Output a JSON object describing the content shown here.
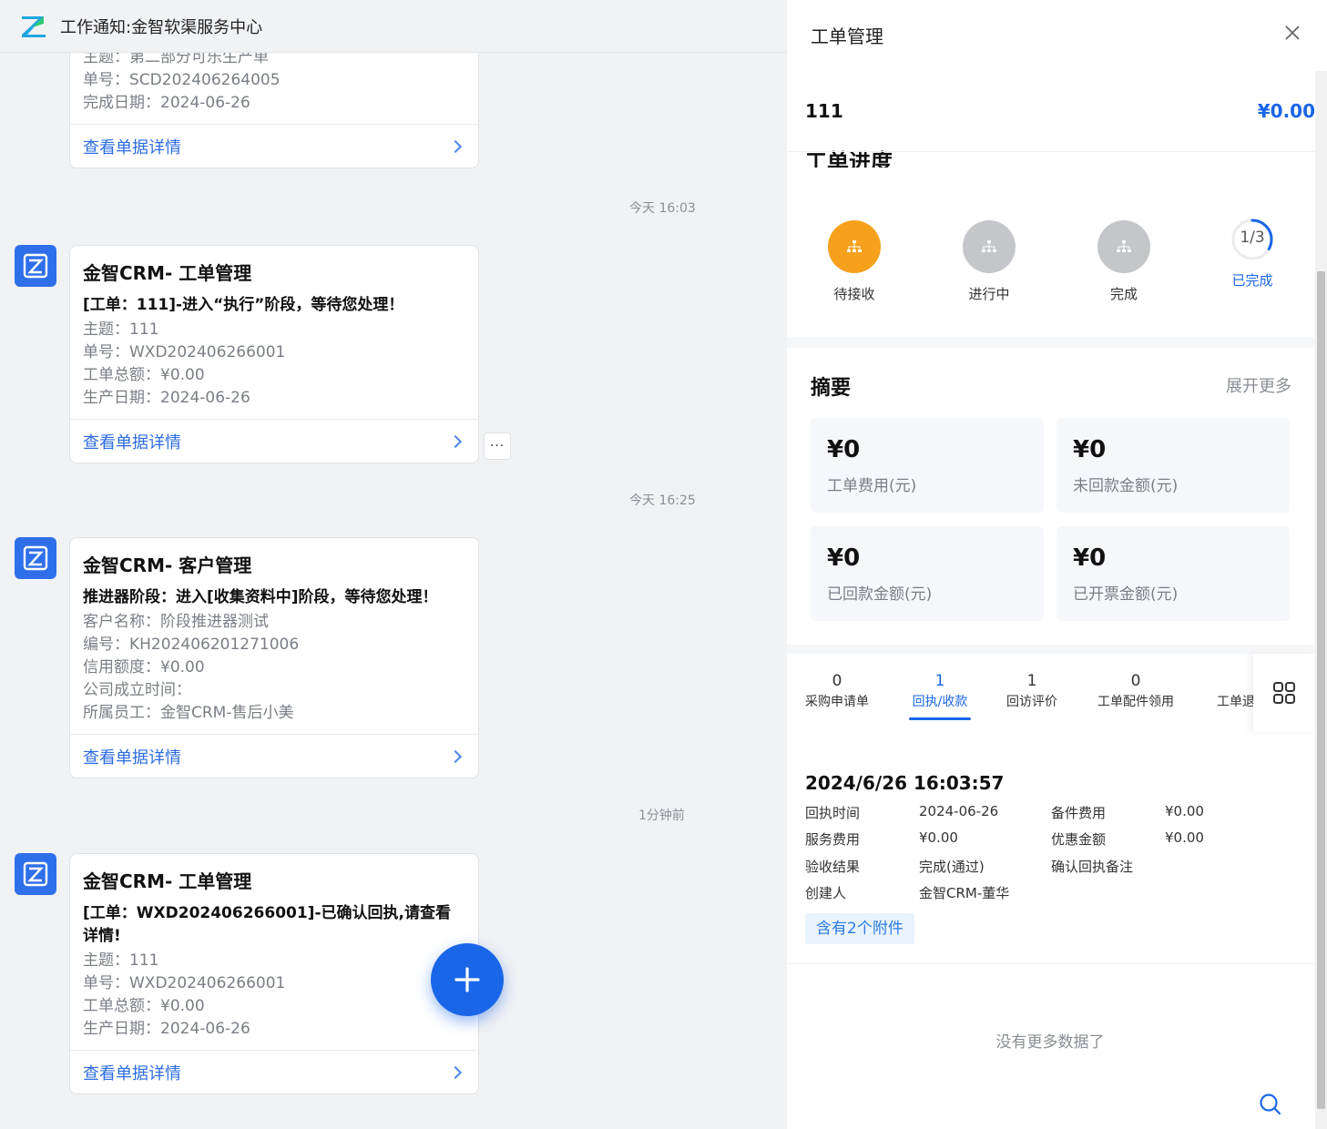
{
  "topbar": {
    "title": "工作通知:金智软渠服务中心"
  },
  "chat": {
    "partial_card": {
      "lines": [
        "主题：第二部分可乐生产单",
        "单号：SCD202406264005",
        "完成日期：2024-06-26"
      ],
      "link": "查看单据详情"
    },
    "messages": [
      {
        "time": "今天 16:03",
        "app": "金智CRM- 工单管理",
        "headline": "[工单：111]-进入“执行”阶段，等待您处理！",
        "lines": [
          "主题：111",
          "单号：WXD202406266001",
          "工单总额：¥0.00",
          "生产日期：2024-06-26"
        ],
        "link": "查看单据详情"
      },
      {
        "time": "今天 16:25",
        "app": "金智CRM- 客户管理",
        "headline": "推进器阶段：进入[收集资料中]阶段，等待您处理！",
        "lines": [
          "客户名称：阶段推进器测试",
          "编号：KH202406201271006",
          "信用额度：¥0.00",
          "公司成立时间：",
          "所属员工：金智CRM-售后小美"
        ],
        "link": "查看单据详情"
      },
      {
        "time": "1分钟前",
        "app": "金智CRM- 工单管理",
        "headline": "[工单：WXD202406266001]-已确认回执,请查看详情!",
        "lines": [
          "主题：111",
          "单号：WXD202406266001",
          "工单总额：¥0.00",
          "生产日期：2024-06-26"
        ],
        "link": "查看单据详情"
      }
    ],
    "more_button": "···"
  },
  "panel": {
    "title": "工单管理",
    "order_name": "111",
    "order_amount": "¥0.00",
    "progress_title": "工单进度",
    "steps": [
      {
        "label": "待接收",
        "state": "current"
      },
      {
        "label": "进行中",
        "state": "pending"
      },
      {
        "label": "完成",
        "state": "pending"
      }
    ],
    "progress_ratio": "1/3",
    "progress_fraction": 0.333,
    "progress_label": "已完成",
    "summary": {
      "title": "摘要",
      "expand": "展开更多",
      "tiles": [
        {
          "value": "¥0",
          "label": "工单费用(元)"
        },
        {
          "value": "¥0",
          "label": "未回款金额(元)"
        },
        {
          "value": "¥0",
          "label": "已回款金额(元)"
        },
        {
          "value": "¥0",
          "label": "已开票金额(元)"
        }
      ]
    },
    "tabs": [
      {
        "count": "0",
        "label": "采购申请单"
      },
      {
        "count": "1",
        "label": "回执/收款",
        "active": true
      },
      {
        "count": "1",
        "label": "回访评价"
      },
      {
        "count": "0",
        "label": "工单配件领用"
      },
      {
        "count": "",
        "label": "工单退"
      }
    ],
    "record": {
      "datetime": "2024/6/26 16:03:57",
      "fields": [
        {
          "k": "回执时间",
          "v": "2024-06-26"
        },
        {
          "k": "备件费用",
          "v": "¥0.00"
        },
        {
          "k": "服务费用",
          "v": "¥0.00"
        },
        {
          "k": "优惠金额",
          "v": "¥0.00"
        },
        {
          "k": "验收结果",
          "v": "完成(通过)"
        },
        {
          "k": "确认回执备注",
          "v": ""
        },
        {
          "k": "创建人",
          "v": "金智CRM-董华"
        }
      ],
      "attachments": "含有2个附件"
    },
    "no_more": "没有更多数据了"
  },
  "colors": {
    "accent": "#1a66e8",
    "step_current": "#f7a01c",
    "step_pending": "#c4c6ca",
    "brand_avatar": "#2f6fea"
  }
}
